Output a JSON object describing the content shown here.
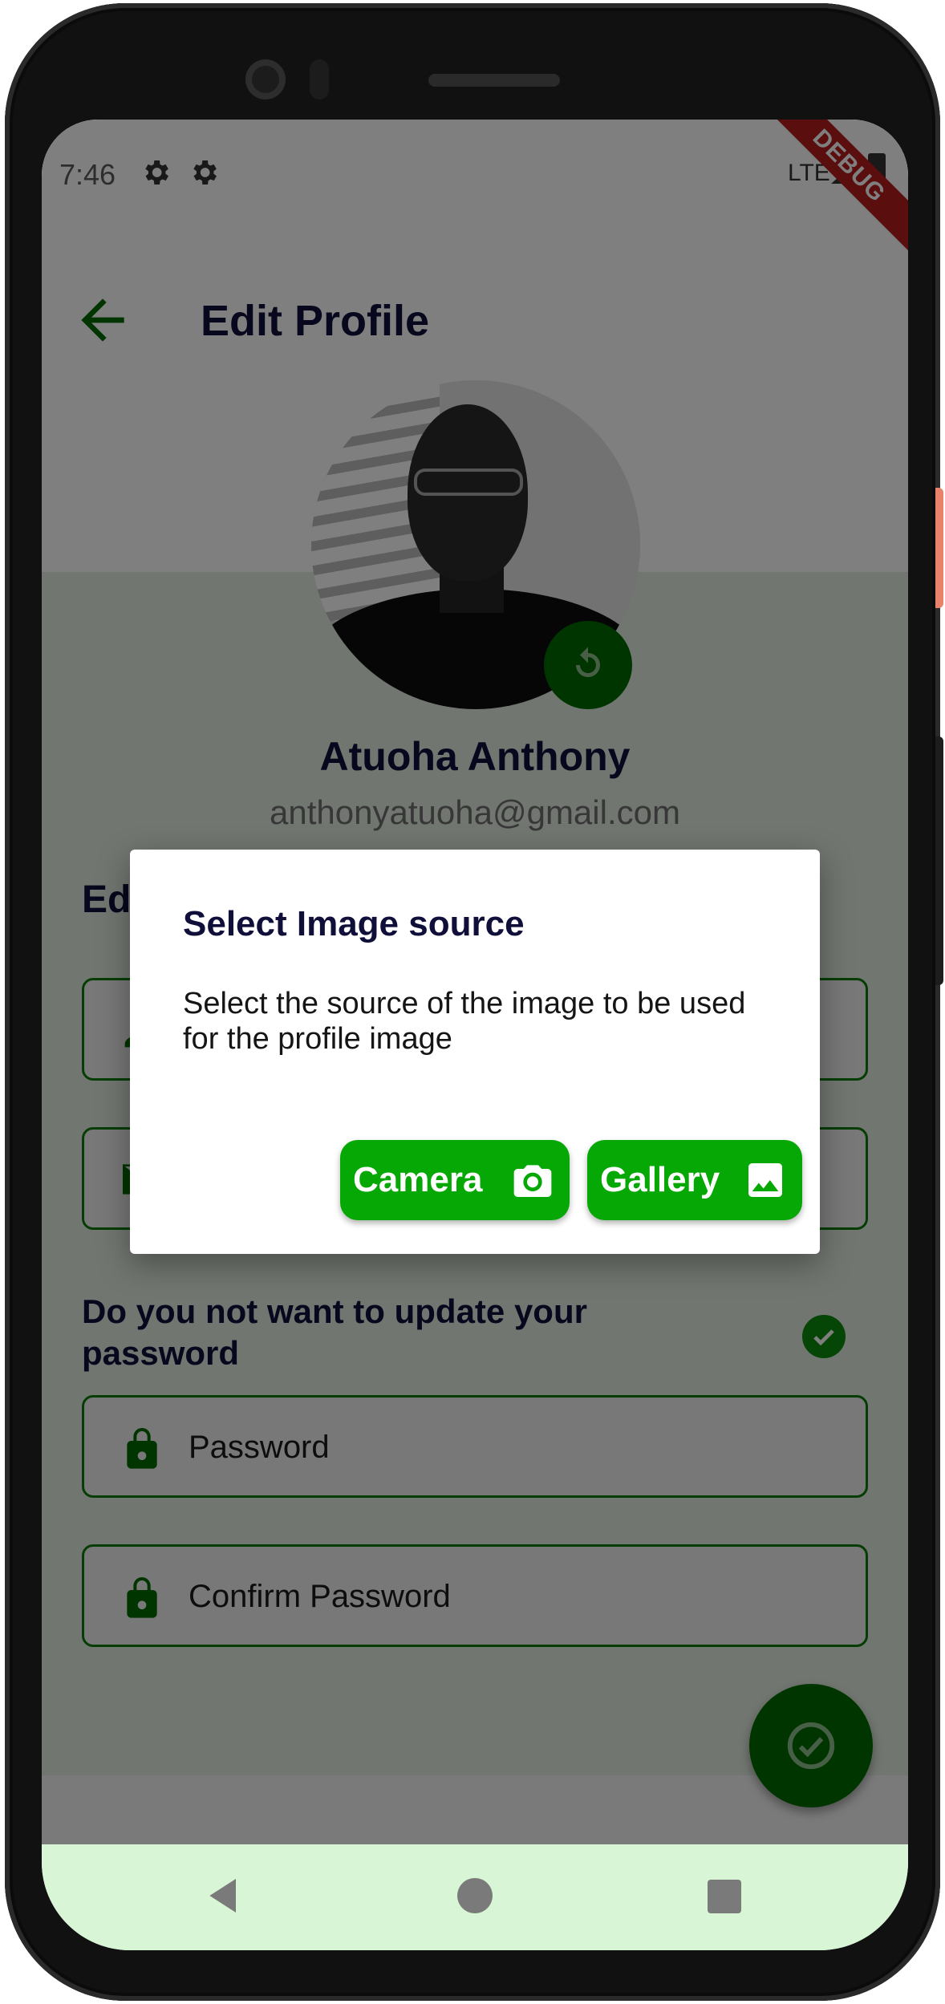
{
  "status_bar": {
    "time": "7:46",
    "network": "LTE",
    "debug_label": "DEBUG"
  },
  "app_bar": {
    "title": "Edit Profile"
  },
  "profile": {
    "name": "Atuoha Anthony",
    "email": "anthonyatuoha@gmail.com"
  },
  "section": {
    "title": "Ed"
  },
  "password_section": {
    "question": "Do you not want to update your password",
    "password_label": "Password",
    "confirm_label": "Confirm Password"
  },
  "dialog": {
    "title": "Select Image source",
    "body": "Select the source of the image to be used for the profile image",
    "camera_label": "Camera",
    "gallery_label": "Gallery"
  },
  "icons": {
    "back": "arrow-left-icon",
    "refresh": "refresh-icon",
    "person": "person-icon",
    "email": "email-icon",
    "lock": "lock-icon",
    "check": "check-circle-icon",
    "camera": "camera-icon",
    "gallery": "image-icon",
    "settings": "gear-icon"
  },
  "colors": {
    "primary_green": "#006b00",
    "button_green": "#05a805",
    "title_navy": "#0f0f3a",
    "nav_bar": "#d8f6d6"
  }
}
